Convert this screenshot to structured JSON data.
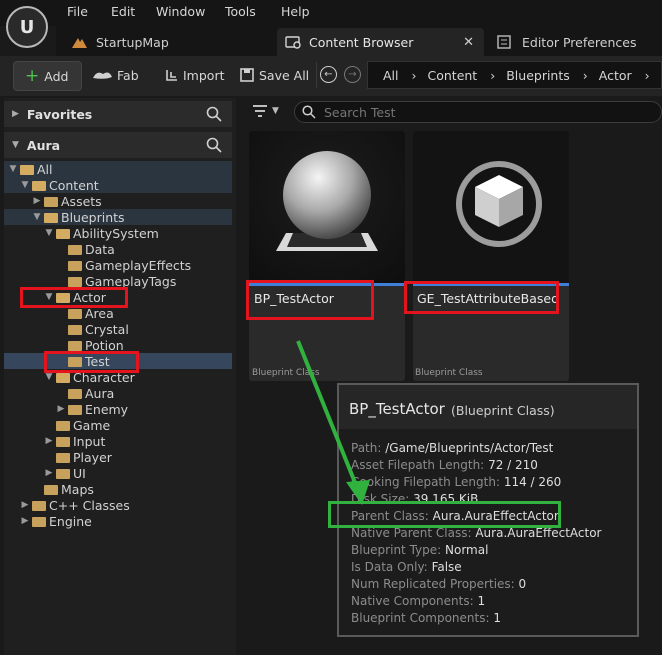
{
  "menu": [
    "File",
    "Edit",
    "Window",
    "Tools",
    "Help"
  ],
  "tabs": {
    "startup_map": "StartupMap",
    "content_browser": "Content Browser",
    "editor_preferences": "Editor Preferences"
  },
  "toolbar": {
    "add": "Add",
    "fab": "Fab",
    "import": "Import",
    "save_all": "Save All",
    "breadcrumbs": [
      "All",
      "Content",
      "Blueprints",
      "Actor"
    ]
  },
  "left": {
    "favorites": "Favorites",
    "project": "Aura",
    "tree": [
      {
        "label": "All"
      },
      {
        "label": "Content"
      },
      {
        "label": "Assets"
      },
      {
        "label": "Blueprints"
      },
      {
        "label": "AbilitySystem"
      },
      {
        "label": "Data"
      },
      {
        "label": "GameplayEffects"
      },
      {
        "label": "GameplayTags"
      },
      {
        "label": "Actor"
      },
      {
        "label": "Area"
      },
      {
        "label": "Crystal"
      },
      {
        "label": "Potion"
      },
      {
        "label": "Test"
      },
      {
        "label": "Character"
      },
      {
        "label": "Aura"
      },
      {
        "label": "Enemy"
      },
      {
        "label": "Game"
      },
      {
        "label": "Input"
      },
      {
        "label": "Player"
      },
      {
        "label": "UI"
      },
      {
        "label": "Maps"
      },
      {
        "label": "C++ Classes"
      },
      {
        "label": "Engine"
      }
    ]
  },
  "search": {
    "placeholder": "Search Test"
  },
  "assets": [
    {
      "name": "BP_TestActor",
      "type": "Blueprint Class"
    },
    {
      "name": "GE_TestAttributeBased",
      "type": "Blueprint Class"
    }
  ],
  "tooltip": {
    "title": "BP_TestActor",
    "subtitle": "(Blueprint Class)",
    "rows": [
      {
        "k": "Path:",
        "v": "/Game/Blueprints/Actor/Test"
      },
      {
        "k": "Asset Filepath Length:",
        "v": "72 / 210"
      },
      {
        "k": "Cooking Filepath Length:",
        "v": "114 / 260"
      },
      {
        "k": "Disk Size:",
        "v": "39.165 KiB"
      },
      {
        "k": "Parent Class:",
        "v": "Aura.AuraEffectActor"
      },
      {
        "k": "Native Parent Class:",
        "v": "Aura.AuraEffectActor"
      },
      {
        "k": "Blueprint Type:",
        "v": "Normal"
      },
      {
        "k": "Is Data Only:",
        "v": "False"
      },
      {
        "k": "Num Replicated Properties:",
        "v": "0"
      },
      {
        "k": "Native Components:",
        "v": "1"
      },
      {
        "k": "Blueprint Components:",
        "v": "1"
      }
    ]
  },
  "colors": {
    "annotation_red": "#e3141e",
    "annotation_green": "#31b23f",
    "selection": "#36475d"
  }
}
